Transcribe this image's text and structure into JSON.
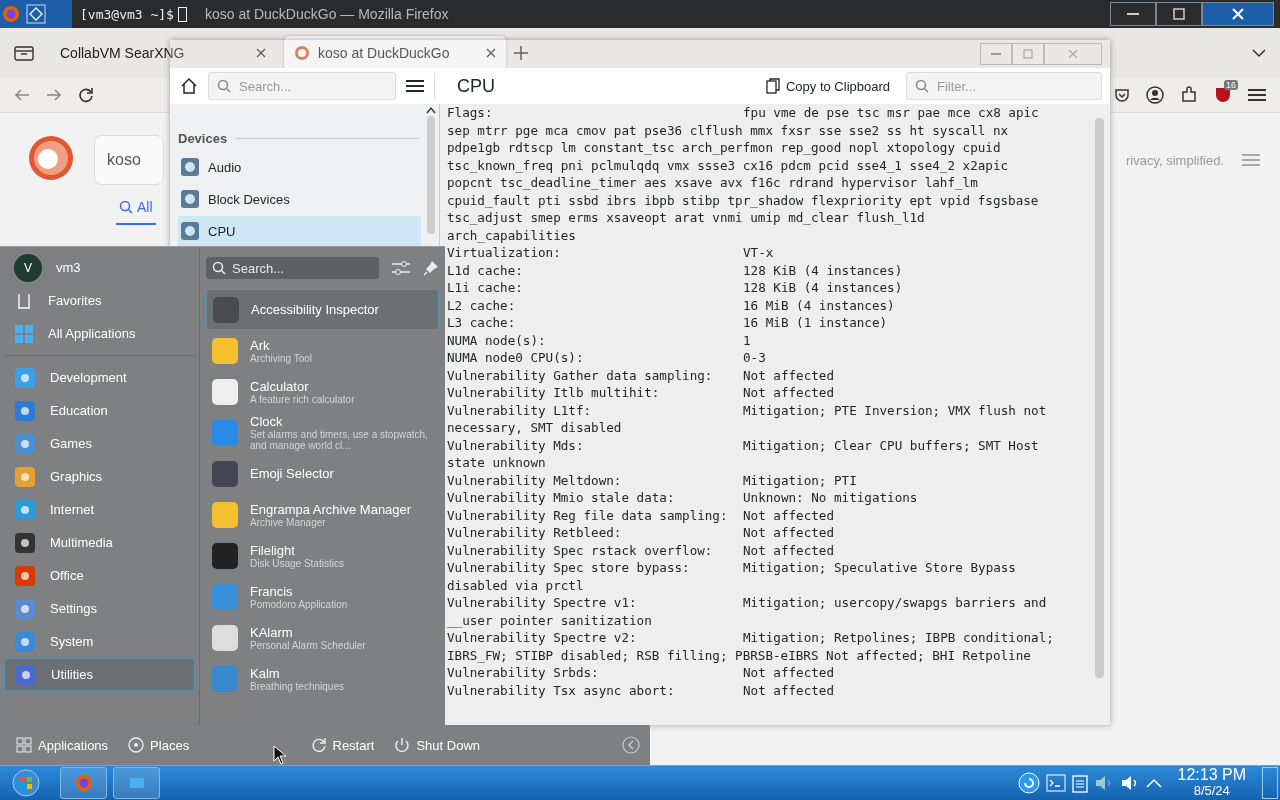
{
  "top_bar": {
    "terminal_prompt": "[vm3@vm3 ~]$",
    "title": "koso at DuckDuckGo — Mozilla Firefox"
  },
  "firefox": {
    "tabs": [
      {
        "label": "CollabVM SearXNG",
        "selected": false
      },
      {
        "label": "koso at DuckDuckGo",
        "selected": true
      }
    ],
    "extension_badge": "16",
    "search": {
      "value": "koso"
    },
    "search_tabs": [
      {
        "label": "All",
        "selected": true
      }
    ],
    "tagline": "rivacy, simplified."
  },
  "info_center": {
    "search": {
      "placeholder": "Search..."
    },
    "heading": "CPU",
    "copy_button": "Copy to Clipboard",
    "filter": {
      "placeholder": "Filter..."
    },
    "sidebar": {
      "sections": [
        {
          "title": "Devices",
          "items": [
            {
              "label": "Audio",
              "selected": false
            },
            {
              "label": "Block Devices",
              "selected": false
            },
            {
              "label": "CPU",
              "selected": true
            }
          ]
        }
      ]
    },
    "lines": [
      {
        "label": "Flags:",
        "value": "fpu vme de pse tsc msr pae mce cx8 apic"
      },
      {
        "label": "sep mtrr pge mca cmov pat pse36 clflush mmx fxsr sse sse2 ss ht syscall nx"
      },
      {
        "label": "pdpe1gb rdtscp lm constant_tsc arch_perfmon rep_good nopl xtopology cpuid"
      },
      {
        "label": "tsc_known_freq pni pclmulqdq vmx ssse3 cx16 pdcm pcid sse4_1 sse4_2 x2apic"
      },
      {
        "label": "popcnt tsc_deadline_timer aes xsave avx f16c rdrand hypervisor lahf_lm"
      },
      {
        "label": "cpuid_fault pti ssbd ibrs ibpb stibp tpr_shadow flexpriority ept vpid fsgsbase"
      },
      {
        "label": "tsc_adjust smep erms xsaveopt arat vnmi umip md_clear flush_l1d"
      },
      {
        "label": "arch_capabilities"
      },
      {
        "label": "Virtualization:",
        "value": "VT-x"
      },
      {
        "label": "L1d cache:",
        "value": "128 KiB (4 instances)"
      },
      {
        "label": "L1i cache:",
        "value": "128 KiB (4 instances)"
      },
      {
        "label": "L2 cache:",
        "value": "16 MiB (4 instances)"
      },
      {
        "label": "L3 cache:",
        "value": "16 MiB (1 instance)"
      },
      {
        "label": "NUMA node(s):",
        "value": "1"
      },
      {
        "label": "NUMA node0 CPU(s):",
        "value": "0-3"
      },
      {
        "label": "Vulnerability Gather data sampling:",
        "value": "Not affected"
      },
      {
        "label": "Vulnerability Itlb multihit:",
        "value": "Not affected"
      },
      {
        "label": "Vulnerability L1tf:",
        "value": "Mitigation; PTE Inversion; VMX flush not"
      },
      {
        "label": "necessary, SMT disabled"
      },
      {
        "label": "Vulnerability Mds:",
        "value": "Mitigation; Clear CPU buffers; SMT Host"
      },
      {
        "label": "state unknown"
      },
      {
        "label": "Vulnerability Meltdown:",
        "value": "Mitigation; PTI"
      },
      {
        "label": "Vulnerability Mmio stale data:",
        "value": "Unknown: No mitigations"
      },
      {
        "label": "Vulnerability Reg file data sampling:",
        "value": "Not affected"
      },
      {
        "label": "Vulnerability Retbleed:",
        "value": "Not affected"
      },
      {
        "label": "Vulnerability Spec rstack overflow:",
        "value": "Not affected"
      },
      {
        "label": "Vulnerability Spec store bypass:",
        "value": "Mitigation; Speculative Store Bypass"
      },
      {
        "label": "disabled via prctl"
      },
      {
        "label": "Vulnerability Spectre v1:",
        "value": "Mitigation; usercopy/swapgs barriers and"
      },
      {
        "label": "__user pointer sanitization"
      },
      {
        "label": "Vulnerability Spectre v2:",
        "value": "Mitigation; Retpolines; IBPB conditional;"
      },
      {
        "label": "IBRS_FW; STIBP disabled; RSB filling; PBRSB-eIBRS Not affected; BHI Retpoline"
      },
      {
        "label": "Vulnerability Srbds:",
        "value": "Not affected"
      },
      {
        "label": "Vulnerability Tsx async abort:",
        "value": "Not affected"
      }
    ]
  },
  "start_menu": {
    "user": "vm3",
    "avatar_letter": "V",
    "nav": [
      {
        "label": "Favorites",
        "selected": false
      },
      {
        "label": "All Applications",
        "selected": false
      }
    ],
    "categories": [
      {
        "label": "Development",
        "selected": false
      },
      {
        "label": "Education",
        "selected": false
      },
      {
        "label": "Games",
        "selected": false
      },
      {
        "label": "Graphics",
        "selected": false
      },
      {
        "label": "Internet",
        "selected": false
      },
      {
        "label": "Multimedia",
        "selected": false
      },
      {
        "label": "Office",
        "selected": false
      },
      {
        "label": "Settings",
        "selected": false
      },
      {
        "label": "System",
        "selected": false
      },
      {
        "label": "Utilities",
        "selected": true
      }
    ],
    "search": {
      "placeholder": "Search..."
    },
    "apps": [
      {
        "name": "Accessibility Inspector",
        "selected": true
      },
      {
        "name": "Ark",
        "description": "Archiving Tool",
        "selected": false
      },
      {
        "name": "Calculator",
        "description": "A feature rich calculator",
        "selected": false
      },
      {
        "name": "Clock",
        "description": "Set alarms and timers, use a stopwatch, and manage world cl...",
        "selected": false
      },
      {
        "name": "Emoji Selector",
        "selected": false
      },
      {
        "name": "Engrampa Archive Manager",
        "description": "Archive Manager",
        "selected": false
      },
      {
        "name": "Filelight",
        "description": "Disk Usage Statistics",
        "selected": false
      },
      {
        "name": "Francis",
        "description": "Pomodoro Application",
        "selected": false
      },
      {
        "name": "KAlarm",
        "description": "Personal Alarm Scheduler",
        "selected": false
      },
      {
        "name": "Kalm",
        "description": "Breathing techniques",
        "selected": false
      }
    ],
    "footer_tabs": [
      "Applications",
      "Places"
    ],
    "actions": [
      "Restart",
      "Shut Down"
    ]
  },
  "taskbar": {
    "time": "12:13 PM",
    "date": "8/5/24"
  }
}
